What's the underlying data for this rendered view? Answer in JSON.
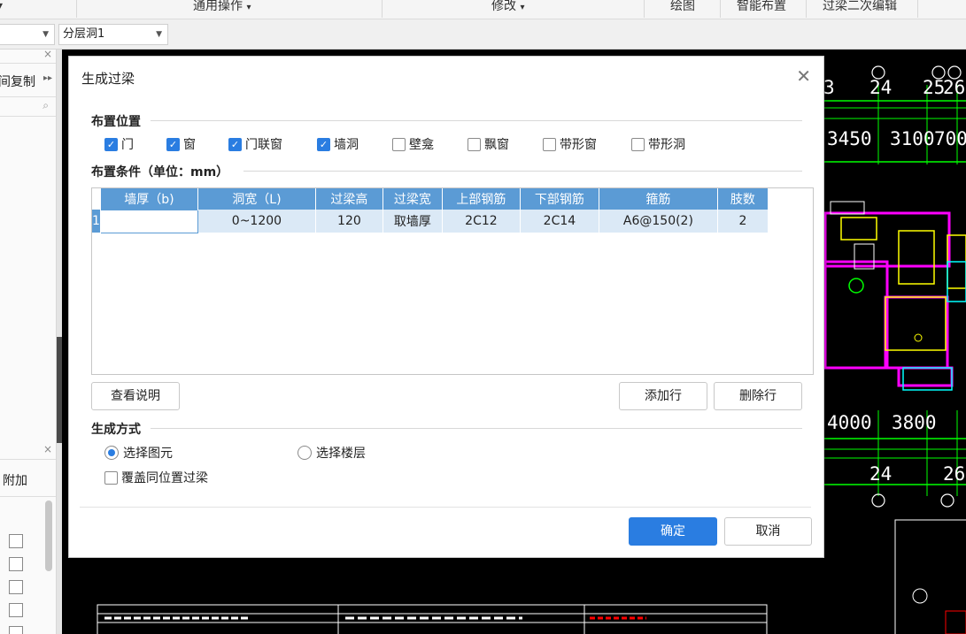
{
  "menu": {
    "common_ops": "通用操作",
    "modify": "修改",
    "draw": "绘图",
    "smart_layout": "智能布置",
    "lintel_edit": "过梁二次编辑"
  },
  "toolbar2": {
    "combo2": "分层洞1"
  },
  "leftpanel": {
    "copy_label": "间复制",
    "extra_label": "附加"
  },
  "cad": {
    "numbers": [
      "3450",
      "3100",
      "700",
      "4000",
      "3800",
      "24",
      "24",
      "25",
      "26",
      "26",
      "3"
    ]
  },
  "dialog": {
    "title": "生成过梁",
    "sec_position": "布置位置",
    "checkboxes": [
      {
        "label": "门",
        "checked": true
      },
      {
        "label": "窗",
        "checked": true
      },
      {
        "label": "门联窗",
        "checked": true
      },
      {
        "label": "墙洞",
        "checked": true
      },
      {
        "label": "壁龛",
        "checked": false
      },
      {
        "label": "飘窗",
        "checked": false
      },
      {
        "label": "带形窗",
        "checked": false
      },
      {
        "label": "带形洞",
        "checked": false
      }
    ],
    "sec_condition": "布置条件（单位：mm）",
    "table": {
      "headers": [
        "墙厚（b)",
        "洞宽（L)",
        "过梁高",
        "过梁宽",
        "上部钢筋",
        "下部钢筋",
        "箍筋",
        "肢数"
      ],
      "rows": [
        {
          "no": "1",
          "cells": [
            "",
            "0~1200",
            "120",
            "取墙厚",
            "2C12",
            "2C14",
            "A6@150(2)",
            "2"
          ]
        }
      ]
    },
    "btn_view_help": "查看说明",
    "btn_add_row": "添加行",
    "btn_delete_row": "删除行",
    "sec_method": "生成方式",
    "radio_select_element": "选择图元",
    "radio_select_floor": "选择楼层",
    "radio_selected": "选择图元",
    "cb_overwrite": "覆盖同位置过梁",
    "cb_overwrite_checked": false,
    "btn_ok": "确定",
    "btn_cancel": "取消"
  },
  "colors": {
    "accent": "#2a7de1",
    "table_header": "#5b9bd5",
    "table_row": "#dbe9f6",
    "cad_background": "#000000"
  }
}
